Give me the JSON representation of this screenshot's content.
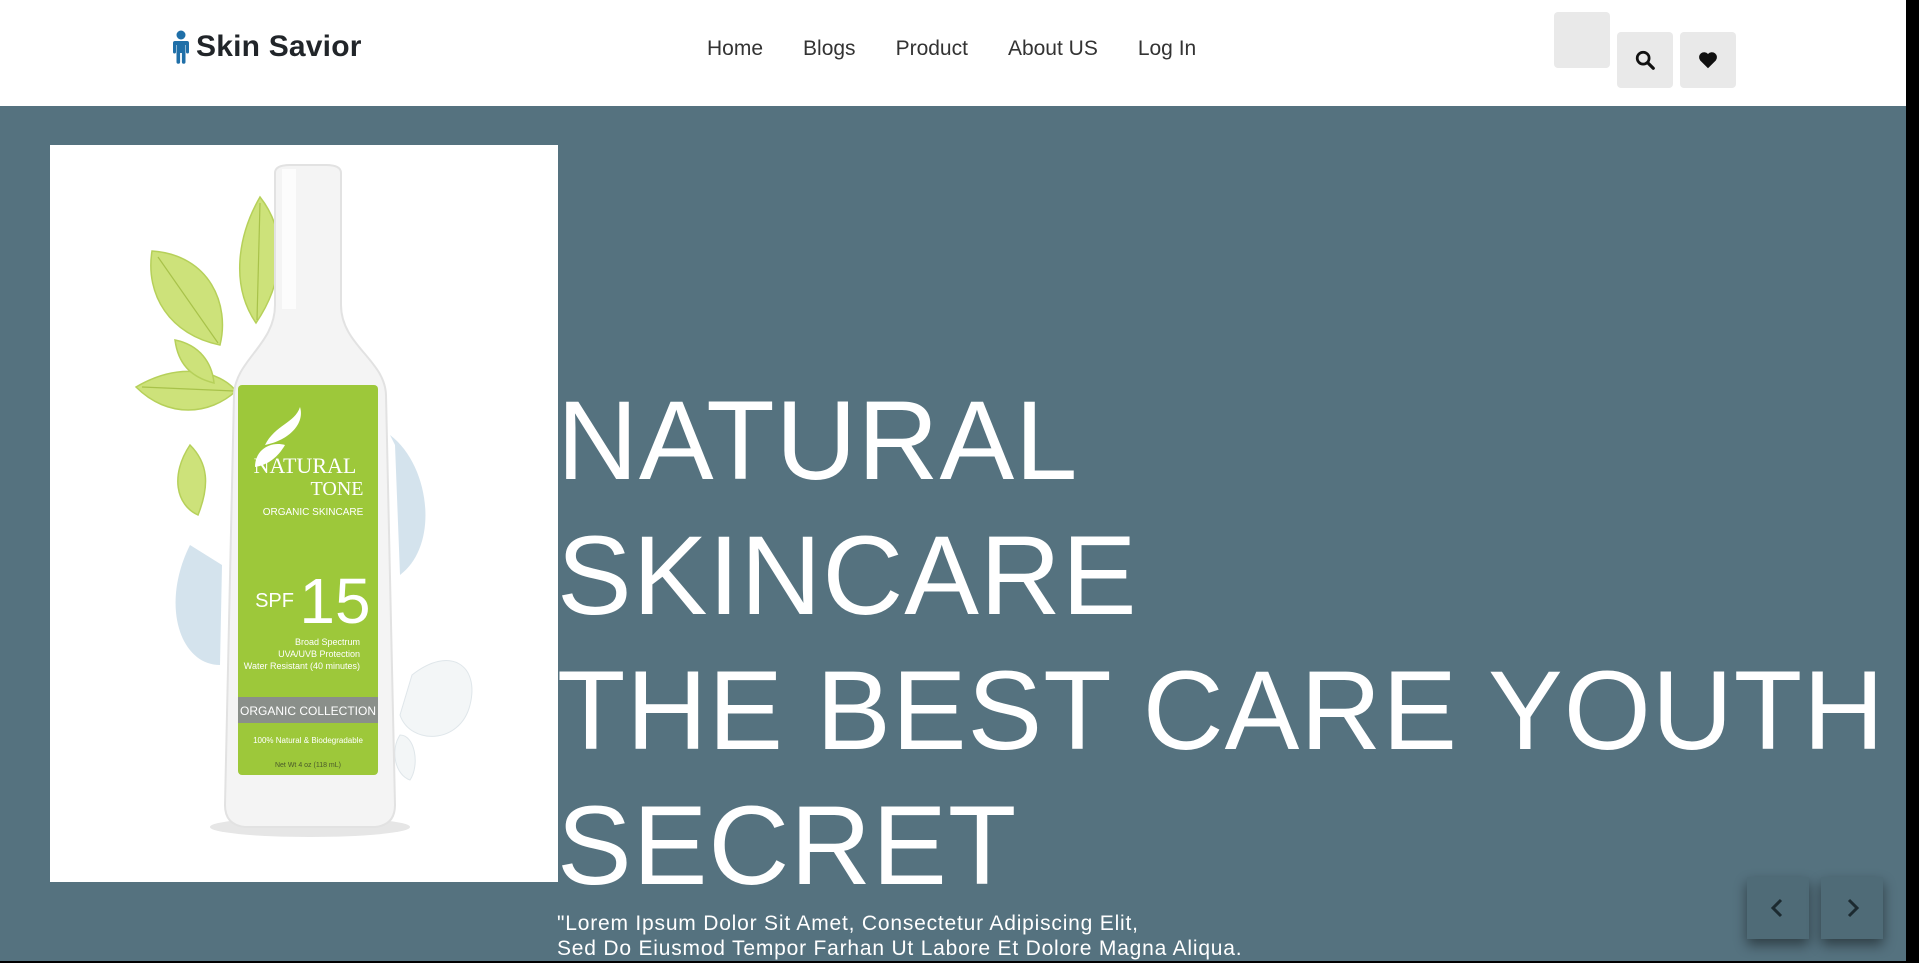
{
  "header": {
    "brand_name": "Skin Savior",
    "brand_icon": "person-icon",
    "nav": [
      {
        "label": "Home"
      },
      {
        "label": "Blogs"
      },
      {
        "label": "Product"
      },
      {
        "label": "About US"
      },
      {
        "label": "Log In"
      }
    ],
    "buttons": {
      "search_icon": "search-icon",
      "wishlist_icon": "heart-icon"
    }
  },
  "hero": {
    "background_color": "#55727f",
    "headline_lines": [
      "NATURAL",
      "SKINCARE",
      "THE BEST CARE YOUTH",
      "SECRET"
    ],
    "description_lines": [
      "\"Lorem Ipsum Dolor Sit Amet, Consectetur Adipiscing Elit,",
      "Sed Do Eiusmod Tempor Farhan Ut Labore Et Dolore Magna Aliqua."
    ],
    "product_image": {
      "brand_line1": "NATURAL",
      "brand_line2": "TONE",
      "subtitle": "ORGANIC SKINCARE",
      "spf_label": "SPF",
      "spf_value": "15",
      "details": [
        "Broad Spectrum",
        "UVA/UVB Protection",
        "Water Resistant (40 minutes)"
      ],
      "band_text": "ORGANIC COLLECTION",
      "footer_text": "100% Natural & Biodegradable",
      "volume_text": "Net Wt 4 oz (118 mL)",
      "label_color": "#9dc83a"
    },
    "carousel": {
      "prev_icon": "chevron-left-icon",
      "next_icon": "chevron-right-icon"
    }
  }
}
